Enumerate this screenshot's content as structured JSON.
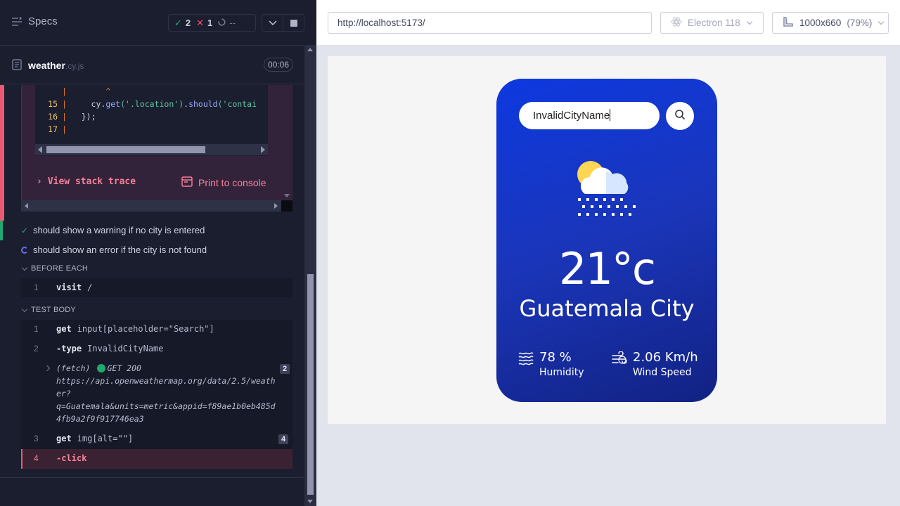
{
  "runner": {
    "specs_label": "Specs",
    "stats": {
      "passed": "2",
      "failed": "1",
      "pending": "--"
    },
    "spec": {
      "name": "weather",
      "ext": ".cy.js",
      "duration": "00:06"
    },
    "code_frame": {
      "lines": [
        {
          "num": "",
          "code": "        ^"
        },
        {
          "num": "15",
          "code_prefix": "     cy.",
          "fn1": "get",
          "arg1": "('.location')",
          "mid": ".",
          "fn2": "should",
          "arg2": "('contai"
        },
        {
          "num": "16",
          "code": "   });"
        },
        {
          "num": "17",
          "code": ""
        }
      ]
    },
    "error_actions": {
      "view_stack_trace": "View stack trace",
      "print_to_console": "Print to console"
    },
    "tests": [
      {
        "title": "should show a warning if no city is entered",
        "state": "passed"
      },
      {
        "title": "should show an error if the city is not found",
        "state": "running"
      }
    ],
    "hooks": {
      "before_each": {
        "label": "BEFORE EACH",
        "commands": [
          {
            "num": "1",
            "name": "visit",
            "message": "/"
          }
        ]
      },
      "test_body": {
        "label": "TEST BODY",
        "commands": [
          {
            "num": "1",
            "name": "get",
            "message": "input[placeholder=\"Search\"]"
          },
          {
            "num": "2",
            "name": "-type",
            "message": "InvalidCityName"
          },
          {
            "num": "3",
            "name": "get",
            "message": "img[alt=\"\"]",
            "badge": "4"
          },
          {
            "num": "4",
            "name": "-click",
            "message": ""
          }
        ],
        "fetch": {
          "label": "(fetch)",
          "status": "GET 200",
          "url": "https://api.openweathermap.org/data/2.5/weather?q=Guatemala&units=metric&appid=f89ae1b0eb485d4fb9a2f9f917746ea3",
          "url_lines": [
            "https://api.openweathermap.org/data/2.5/weath",
            "er?",
            "q=Guatemala&units=metric&appid=f89ae1b0eb485d",
            "4fb9a2f9f917746ea3"
          ],
          "badge": "2"
        }
      }
    }
  },
  "aut": {
    "url": "http://localhost:5173/",
    "browser": "Electron 118",
    "viewport": "1000x660",
    "scale": "(79%)",
    "app": {
      "search_value": "InvalidCityName",
      "temperature": "21°c",
      "city": "Guatemala City",
      "humidity_value": "78 %",
      "humidity_label": "Humidity",
      "wind_value": "2.06 Km/h",
      "wind_label": "Wind Speed"
    }
  },
  "colors": {
    "pass": "#1fa971",
    "fail": "#f14c68",
    "card_gradient_start": "#0e39e0",
    "card_gradient_end": "#122283"
  },
  "icons": [
    "specs-menu-icon",
    "check-icon",
    "cross-icon",
    "spinner-icon",
    "chevron-down-icon",
    "stop-icon",
    "file-icon",
    "print-icon",
    "browser-icon",
    "viewport-icon",
    "search-icon",
    "cloud-sun-rain-icon",
    "humidity-icon",
    "wind-icon"
  ]
}
